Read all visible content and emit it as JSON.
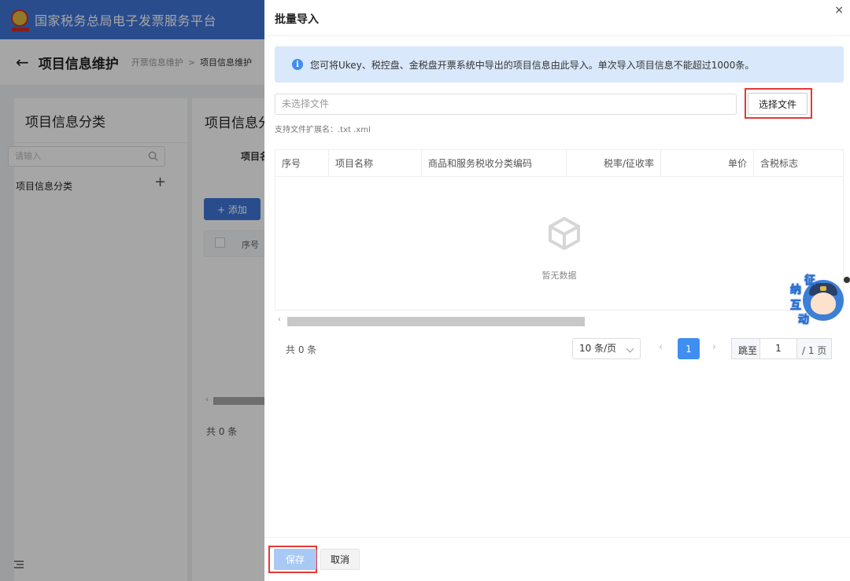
{
  "app": {
    "platform_title": "国家税务总局电子发票服务平台"
  },
  "breadcrumb": {
    "page_title": "项目信息维护",
    "parent": "开票信息维护",
    "separator": ">",
    "current": "项目信息维护"
  },
  "left_panel": {
    "heading": "项目信息分类",
    "search_placeholder": "请输入",
    "tree_item": "项目信息分类",
    "add_glyph": "+"
  },
  "background_right": {
    "heading": "项目信息分",
    "label": "项目名",
    "add_button": "+ 添加",
    "col_seq": "序号",
    "total": "共 0 条"
  },
  "drawer": {
    "title": "批量导入",
    "close_glyph": "×",
    "notice": "您可将Ukey、税控盘、金税盘开票系统中导出的项目信息由此导入。单次导入项目信息不能超过1000条。",
    "file_placeholder": "未选择文件",
    "choose_button": "选择文件",
    "ext_hint": "支持文件扩展名：.txt .xml",
    "table": {
      "columns": [
        "序号",
        "项目名称",
        "商品和服务税收分类编码",
        "税率/征收率",
        "单价",
        "含税标志"
      ],
      "empty_text": "暂无数据"
    },
    "pager": {
      "total": "共 0 条",
      "page_size": "10 条/页",
      "current_page": "1",
      "jump_label": "跳至",
      "jump_value": "1",
      "total_pages": "/ 1 页"
    },
    "assistant_chars": [
      "征",
      "纳",
      "互",
      "动"
    ],
    "save_button": "保存",
    "cancel_button": "取消"
  },
  "colors": {
    "brand_blue": "#3f76d9",
    "info_blue": "#3f8ef0",
    "highlight_red": "#e53935",
    "notice_bg": "#d9e8fb"
  }
}
